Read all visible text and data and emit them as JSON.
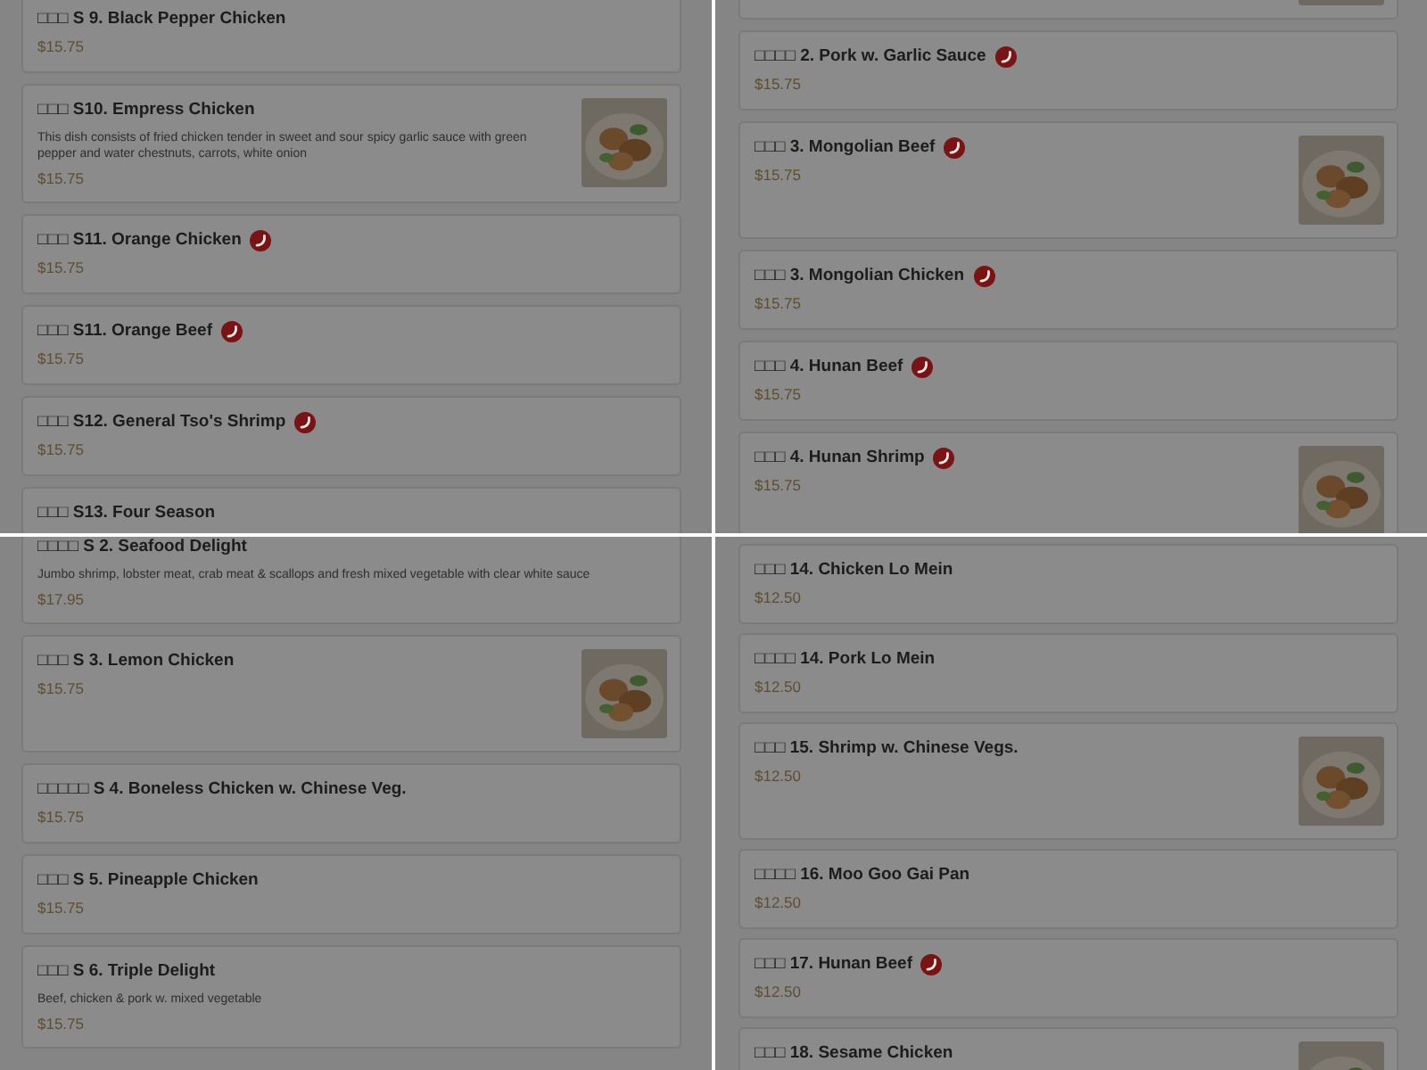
{
  "panels": [
    {
      "items": [
        {
          "name": "□□□ S 9. Black Pepper Chicken",
          "price": "$15.75",
          "spicy": false,
          "photo": false
        },
        {
          "name": "□□□ S10. Empress Chicken",
          "description": "This dish consists of fried chicken tender in sweet and sour spicy garlic sauce with green pepper and water chestnuts, carrots, white onion",
          "price": "$15.75",
          "spicy": false,
          "photo": true
        },
        {
          "name": "□□□ S11. Orange Chicken",
          "price": "$15.75",
          "spicy": true,
          "photo": false
        },
        {
          "name": "□□□ S11. Orange Beef",
          "price": "$15.75",
          "spicy": true,
          "photo": false
        },
        {
          "name": "□□□ S12. General Tso's Shrimp",
          "price": "$15.75",
          "spicy": true,
          "photo": false
        },
        {
          "name": "□□□ S13. Four Season",
          "spicy": false,
          "photo": false
        }
      ]
    },
    {
      "items": [
        {
          "spicy": false,
          "photo": true
        },
        {
          "name": "□□□□ 2. Pork w. Garlic Sauce",
          "price": "$15.75",
          "spicy": true,
          "photo": false
        },
        {
          "name": "□□□ 3. Mongolian Beef",
          "price": "$15.75",
          "spicy": true,
          "photo": true
        },
        {
          "name": "□□□ 3. Mongolian Chicken",
          "price": "$15.75",
          "spicy": true,
          "photo": false
        },
        {
          "name": "□□□ 4. Hunan Beef",
          "price": "$15.75",
          "spicy": true,
          "photo": false
        },
        {
          "name": "□□□ 4. Hunan Shrimp",
          "price": "$15.75",
          "spicy": true,
          "photo": true
        }
      ]
    },
    {
      "items": [
        {
          "name": "□□□□ S 2. Seafood Delight",
          "description": "Jumbo shrimp, lobster meat, crab meat & scallops and fresh mixed vegetable with clear white sauce",
          "price": "$17.95",
          "spicy": false,
          "photo": false
        },
        {
          "name": "□□□ S 3. Lemon Chicken",
          "price": "$15.75",
          "spicy": false,
          "photo": true
        },
        {
          "name": "□□□□□ S 4. Boneless Chicken w. Chinese Veg.",
          "price": "$15.75",
          "spicy": false,
          "photo": false
        },
        {
          "name": "□□□ S 5. Pineapple Chicken",
          "price": "$15.75",
          "spicy": false,
          "photo": false
        },
        {
          "name": "□□□ S 6. Triple Delight",
          "description": "Beef, chicken & pork w. mixed vegetable",
          "price": "$15.75",
          "spicy": false,
          "photo": false
        }
      ]
    },
    {
      "items": [
        {
          "name": "□□□ 14. Chicken Lo Mein",
          "price": "$12.50",
          "spicy": false,
          "photo": false
        },
        {
          "name": "□□□□ 14. Pork Lo Mein",
          "price": "$12.50",
          "spicy": false,
          "photo": false
        },
        {
          "name": "□□□ 15. Shrimp w. Chinese Vegs.",
          "price": "$12.50",
          "spicy": false,
          "photo": true
        },
        {
          "name": "□□□□ 16. Moo Goo Gai Pan",
          "price": "$12.50",
          "spicy": false,
          "photo": false
        },
        {
          "name": "□□□ 17. Hunan Beef",
          "price": "$12.50",
          "spicy": true,
          "photo": false
        },
        {
          "name": "□□□ 18. Sesame Chicken",
          "spicy": false,
          "photo": true
        }
      ]
    }
  ]
}
